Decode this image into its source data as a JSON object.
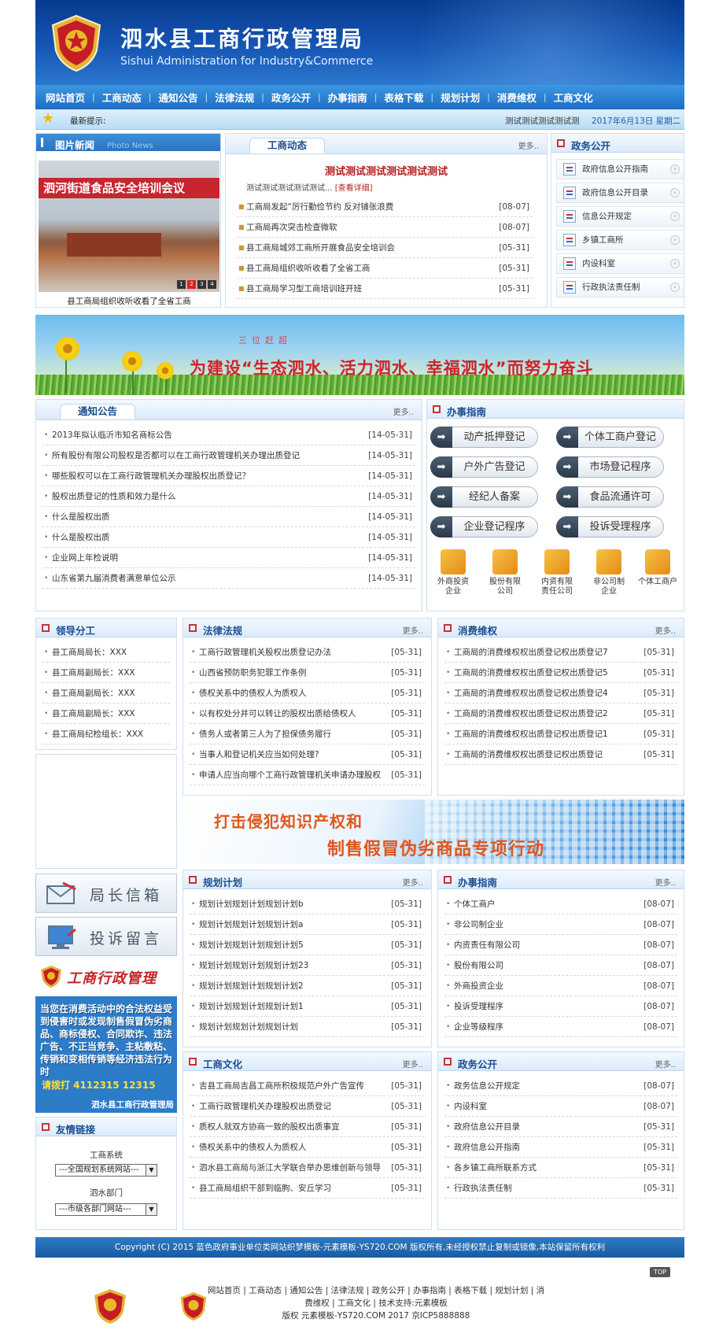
{
  "header": {
    "title": "泗水县工商行政管理局",
    "subtitle": "Sishui Administration for Industry&Commerce"
  },
  "nav": [
    "网站首页",
    "工商动态",
    "通知公告",
    "法律法规",
    "政务公开",
    "办事指南",
    "表格下载",
    "规划计划",
    "消费维权",
    "工商文化"
  ],
  "ticker": {
    "label": "最新提示:",
    "text": "测试测试测试测试测",
    "date": "2017年6月13日 星期二"
  },
  "photo_news": {
    "title": "图片新闻",
    "title_en": "Photo News",
    "banner_text": "泗河街道食品安全培训会议",
    "caption": "县工商局组织收听收看了全省工商",
    "dots": [
      "1",
      "2",
      "3",
      "4"
    ],
    "active_dot": 2
  },
  "news": {
    "tab": "工商动态",
    "more": "更多..",
    "headline": "测试测试测试测试测试测试",
    "summary": "测试测试测试测试测试...",
    "summary_link": "[查看详细]",
    "items": [
      {
        "title": "工商局发起“厉行勤俭节约 反对铺张浪费",
        "date": "[08-07]"
      },
      {
        "title": "工商局再次突击检查微软",
        "date": "[08-07]"
      },
      {
        "title": "县工商局城郊工商所开展食品安全培训会",
        "date": "[05-31]"
      },
      {
        "title": "县工商局组织收听收看了全省工商",
        "date": "[05-31]"
      },
      {
        "title": "县工商局学习型工商培训班开班",
        "date": "[05-31]"
      }
    ]
  },
  "gov_open": {
    "title": "政务公开",
    "items": [
      "政府信息公开指南",
      "政府信息公开目录",
      "信息公开规定",
      "乡镇工商所",
      "内设科室",
      "行政执法责任制"
    ]
  },
  "banner1": {
    "small": "三位赶超",
    "slogan": "为建设“生态泗水、活力泗水、幸福泗水”而努力奋斗"
  },
  "notice": {
    "tab": "通知公告",
    "more": "更多..",
    "items": [
      {
        "title": "2013年拟认临沂市知名商标公告",
        "date": "[14-05-31]"
      },
      {
        "title": "所有股份有限公司股权是否都可以在工商行政管理机关办理出质登记",
        "date": "[14-05-31]"
      },
      {
        "title": "哪些股权可以在工商行政管理机关办理股权出质登记？",
        "date": "[14-05-31]"
      },
      {
        "title": "股权出质登记的性质和效力是什么",
        "date": "[14-05-31]"
      },
      {
        "title": "什么是股权出质",
        "date": "[14-05-31]"
      },
      {
        "title": "什么是股权出质",
        "date": "[14-05-31]"
      },
      {
        "title": "企业网上年检说明",
        "date": "[14-05-31]"
      },
      {
        "title": "山东省第九届消费者满意单位公示",
        "date": "[14-05-31]"
      }
    ]
  },
  "guide": {
    "title": "办事指南",
    "buttons": [
      "动产抵押登记",
      "个体工商户登记",
      "户外广告登记",
      "市场登记程序",
      "经纪人备案",
      "食品流通许可",
      "企业登记程序",
      "投诉受理程序"
    ],
    "icons": [
      {
        "l1": "外商投资",
        "l2": "企业"
      },
      {
        "l1": "股份有限",
        "l2": "公司"
      },
      {
        "l1": "内资有限",
        "l2": "责任公司"
      },
      {
        "l1": "非公司制",
        "l2": "企业"
      },
      {
        "l1": "个体工商户",
        "l2": ""
      }
    ]
  },
  "leaders": {
    "title": "领导分工",
    "items": [
      "县工商局局长：XXX",
      "县工商局副局长：XXX",
      "县工商局副局长：XXX",
      "县工商局副局长：XXX",
      "县工商局纪检组长：XXX"
    ]
  },
  "laws": {
    "title": "法律法规",
    "more": "更多..",
    "items": [
      {
        "title": "工商行政管理机关股权出质登记办法",
        "date": "[05-31]"
      },
      {
        "title": "山西省预防职务犯罪工作条例",
        "date": "[05-31]"
      },
      {
        "title": "债权关系中的债权人为质权人",
        "date": "[05-31]"
      },
      {
        "title": "以有权处分并可以转让的股权出质给债权人",
        "date": "[05-31]"
      },
      {
        "title": "债务人或者第三人为了担保债务履行",
        "date": "[05-31]"
      },
      {
        "title": "当事人和登记机关应当如何处理?",
        "date": "[05-31]"
      },
      {
        "title": "申请人应当向哪个工商行政管理机关申请办理股权",
        "date": "[05-31]"
      }
    ]
  },
  "consumer": {
    "title": "消费维权",
    "more": "更多..",
    "items": [
      {
        "title": "工商局的消费维权权出质登记权出质登记7",
        "date": "[05-31]"
      },
      {
        "title": "工商局的消费维权权出质登记权出质登记5",
        "date": "[05-31]"
      },
      {
        "title": "工商局的消费维权权出质登记权出质登记4",
        "date": "[05-31]"
      },
      {
        "title": "工商局的消费维权权出质登记权出质登记2",
        "date": "[05-31]"
      },
      {
        "title": "工商局的消费维权权出质登记权出质登记1",
        "date": "[05-31]"
      },
      {
        "title": "工商局的消费维权权出质登记权出质登记",
        "date": "[05-31]"
      }
    ]
  },
  "banner2": {
    "line1": "打击侵犯知识产权和",
    "line2": "制售假冒伪劣商品专项行动"
  },
  "side_buttons": {
    "mailbox": "局长信箱",
    "complaint": "投诉留言"
  },
  "ad": {
    "brand": "工商行政管理",
    "text": "当您在消费活动中的合法权益受到侵害时或发现制售假冒伪劣商品、商标侵权、合同欺诈、违法广告、不正当竞争、主粘敷粘、传销和变相传销等经济违法行为时",
    "phone": "请拨打 4112315 12315",
    "footer": "泗水县工商行政管理局"
  },
  "plan": {
    "title": "规划计划",
    "more": "更多..",
    "items": [
      {
        "title": "规划计划规划计划规划计划b",
        "date": "[05-31]"
      },
      {
        "title": "规划计划规划计划规划计划a",
        "date": "[05-31]"
      },
      {
        "title": "规划计划规划计划规划计划5",
        "date": "[05-31]"
      },
      {
        "title": "规划计划规划计划规划计划23",
        "date": "[05-31]"
      },
      {
        "title": "规划计划规划计划规划计划2",
        "date": "[05-31]"
      },
      {
        "title": "规划计划规划计划规划计划1",
        "date": "[05-31]"
      },
      {
        "title": "规划计划规划计划规划计划",
        "date": "[05-31]"
      }
    ]
  },
  "guide2": {
    "title": "办事指南",
    "more": "更多..",
    "items": [
      {
        "title": "个体工商户",
        "date": "[08-07]"
      },
      {
        "title": "非公司制企业",
        "date": "[08-07]"
      },
      {
        "title": "内资责任有限公司",
        "date": "[08-07]"
      },
      {
        "title": "股份有限公司",
        "date": "[08-07]"
      },
      {
        "title": "外商投资企业",
        "date": "[08-07]"
      },
      {
        "title": "投诉受理程序",
        "date": "[08-07]"
      },
      {
        "title": "企业等级程序",
        "date": "[08-07]"
      }
    ]
  },
  "friends": {
    "title": "友情链接",
    "label1": "工商系统",
    "select1": "---全国规划系统网站---",
    "label2": "泗水部门",
    "select2": "---市级各部门网站---"
  },
  "culture": {
    "title": "工商文化",
    "more": "更多..",
    "items": [
      {
        "title": "吉县工商局吉昌工商所积极规范户外广告宣传",
        "date": "[05-31]"
      },
      {
        "title": "工商行政管理机关办理股权出质登记",
        "date": "[05-31]"
      },
      {
        "title": "质权人就双方协商一致的股权出质事宜",
        "date": "[05-31]"
      },
      {
        "title": "债权关系中的债权人为质权人",
        "date": "[05-31]"
      },
      {
        "title": "泗水县工商局与浙江大学联合举办思维创新与领导",
        "date": "[05-31]"
      },
      {
        "title": "县工商局组织干部到临朐、安丘学习",
        "date": "[05-31]"
      }
    ]
  },
  "gov2": {
    "title": "政务公开",
    "more": "更多..",
    "items": [
      {
        "title": "政务信息公开规定",
        "date": "[08-07]"
      },
      {
        "title": "内设科室",
        "date": "[08-07]"
      },
      {
        "title": "政府信息公开目录",
        "date": "[05-31]"
      },
      {
        "title": "政府信息公开指南",
        "date": "[05-31]"
      },
      {
        "title": "各乡镇工商所联系方式",
        "date": "[05-31]"
      },
      {
        "title": "行政执法责任制",
        "date": "[05-31]"
      }
    ]
  },
  "footer": {
    "copyright": "Copyright (C) 2015 蓝色政府事业单位类网站织梦模板-元素模板-YS720.COM 版权所有,未经授权禁止复制或镜像,本站保留所有权利",
    "top": "TOP",
    "nav": "网站首页 | 工商动态 | 通知公告 | 法律法规 | 政务公开 | 办事指南 | 表格下载 | 规划计划 | 消费维权 | 工商文化 | 技术支持:元素模板",
    "copy": "版权 元素模板-YS720.COM 2017   京ICP5888888"
  },
  "colors": {
    "header_blue": "#1656b4",
    "nav_blue": "#2b7fd0",
    "title_blue": "#1a4d91",
    "headline_red": "#b61e1e",
    "accent_red": "#c8323a"
  }
}
